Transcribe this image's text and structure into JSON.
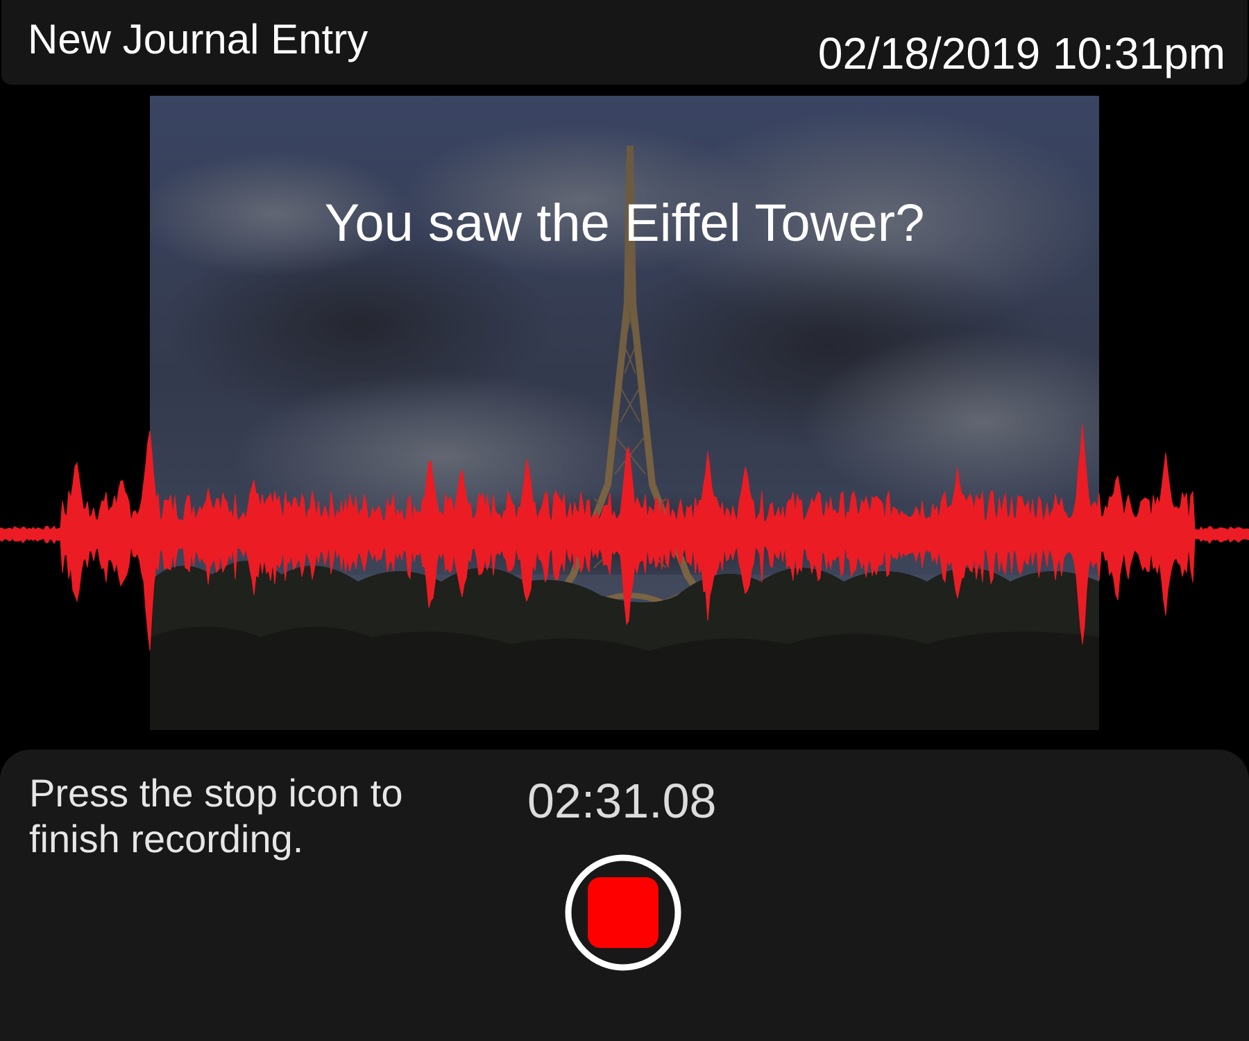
{
  "header": {
    "title": "New Journal Entry",
    "datetime": "02/18/2019 10:31pm"
  },
  "main": {
    "prompt": "You saw the Eiffel Tower?",
    "photo_subject": "eiffel-tower-photo"
  },
  "recorder": {
    "instruction": "Press the stop icon to finish recording.",
    "elapsed": "02:31.08",
    "stop_icon": "stop-icon",
    "waveform_color": "#ec1c24",
    "stop_color": "#ff0000"
  }
}
